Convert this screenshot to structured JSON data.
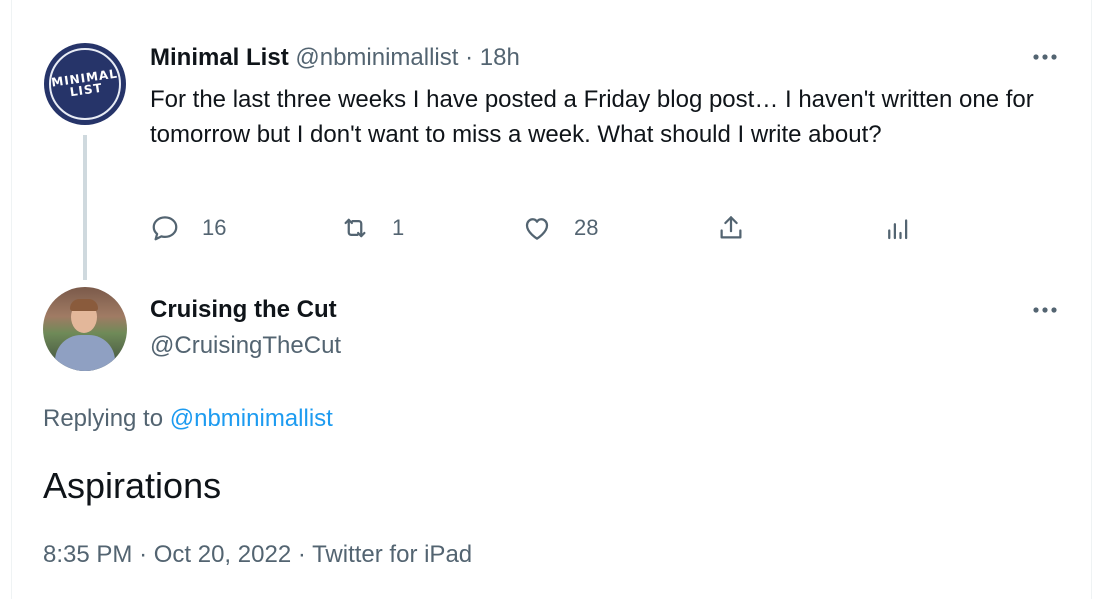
{
  "parent_tweet": {
    "avatar_text_line1": "MINIMAL",
    "avatar_text_line2": "LIST",
    "display_name": "Minimal List",
    "handle": "@nbminimallist",
    "separator": "·",
    "time": "18h",
    "more_icon": "more-horizontal",
    "text": "For the last three weeks I have posted a Friday blog post… I haven't written one for tomorrow but I don't want to miss a week. What should I write about?",
    "actions": {
      "reply_count": "16",
      "retweet_count": "1",
      "like_count": "28"
    }
  },
  "reply_tweet": {
    "display_name": "Cruising the Cut",
    "handle": "@CruisingTheCut",
    "more_icon": "more-horizontal",
    "replying_label": "Replying to",
    "replying_to": "@nbminimallist",
    "text": "Aspirations",
    "time": "8:35 PM",
    "separator": "·",
    "date": "Oct 20, 2022",
    "source": "Twitter for iPad"
  },
  "colors": {
    "text_primary": "#0f1419",
    "text_secondary": "#536471",
    "link": "#1d9bf0",
    "thread_line": "#cfd9de",
    "avatar_bg": "#263469"
  }
}
